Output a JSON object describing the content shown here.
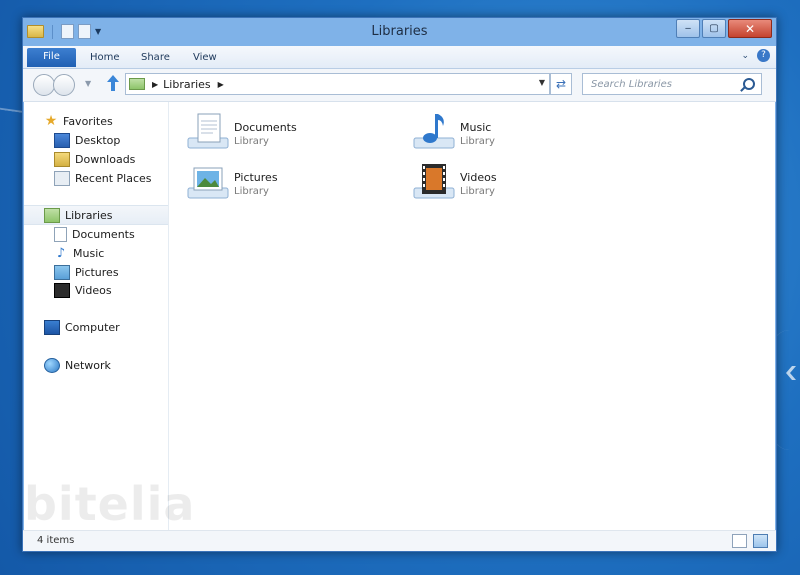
{
  "window": {
    "title": "Libraries"
  },
  "caption": {
    "minimize": "‒",
    "maximize": "▢",
    "close": "✕"
  },
  "ribbon": {
    "tabs": [
      "File",
      "Home",
      "Share",
      "View"
    ]
  },
  "address": {
    "crumb": "Libraries"
  },
  "search": {
    "placeholder": "Search Libraries"
  },
  "sidebar": {
    "favorites": {
      "label": "Favorites",
      "items": [
        "Desktop",
        "Downloads",
        "Recent Places"
      ]
    },
    "libraries": {
      "label": "Libraries",
      "items": [
        "Documents",
        "Music",
        "Pictures",
        "Videos"
      ]
    },
    "computer": "Computer",
    "network": "Network"
  },
  "libraries": [
    {
      "name": "Documents",
      "type": "Library"
    },
    {
      "name": "Music",
      "type": "Library"
    },
    {
      "name": "Pictures",
      "type": "Library"
    },
    {
      "name": "Videos",
      "type": "Library"
    }
  ],
  "status": {
    "count": "4 items"
  },
  "watermark": "bitelia",
  "colors": {
    "accent": "#1f5fb3",
    "window_frame": "#7fb2e8",
    "close": "#c5432e"
  }
}
